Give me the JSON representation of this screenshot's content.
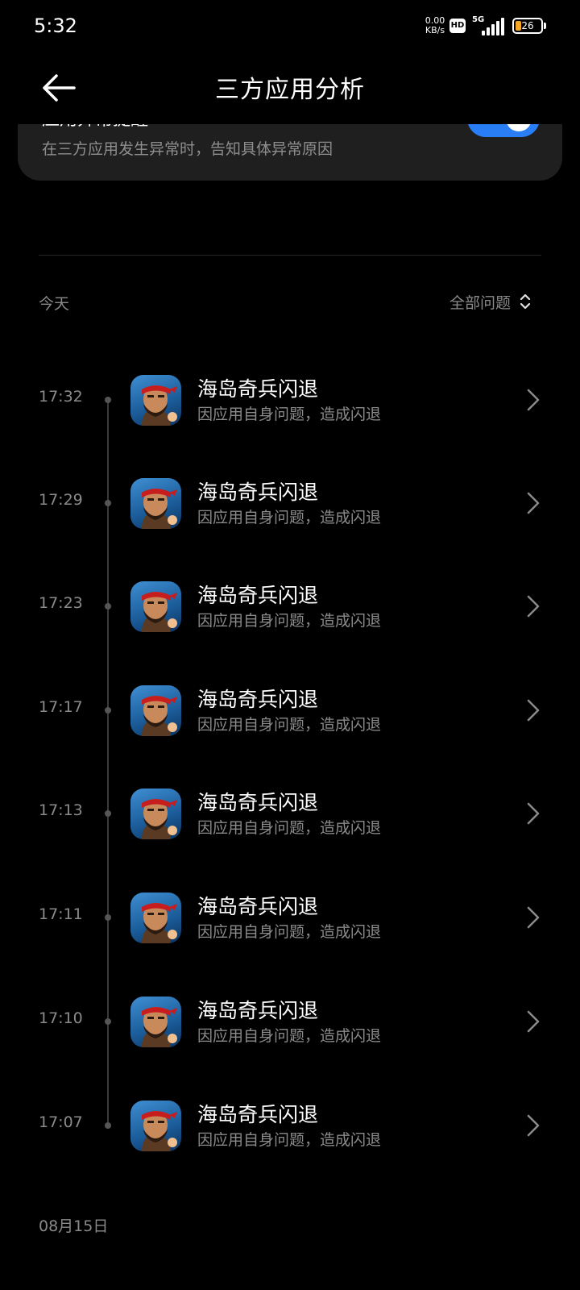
{
  "status_bar": {
    "time": "5:32",
    "net_speed_value": "0.00",
    "net_speed_unit": "KB/s",
    "hd_label": "HD",
    "network_type": "5G",
    "battery_level": "26"
  },
  "header": {
    "title": "三方应用分析"
  },
  "settings_card": {
    "title": "应用异常提醒",
    "description": "在三方应用发生异常时，告知具体异常原因",
    "toggle_on": true
  },
  "section_today": {
    "label": "今天",
    "filter_label": "全部问题"
  },
  "records": [
    {
      "time": "17:32",
      "app_name": "海岛奇兵闪退",
      "reason": "因应用自身问题，造成闪退"
    },
    {
      "time": "17:29",
      "app_name": "海岛奇兵闪退",
      "reason": "因应用自身问题，造成闪退"
    },
    {
      "time": "17:23",
      "app_name": "海岛奇兵闪退",
      "reason": "因应用自身问题，造成闪退"
    },
    {
      "time": "17:17",
      "app_name": "海岛奇兵闪退",
      "reason": "因应用自身问题，造成闪退"
    },
    {
      "time": "17:13",
      "app_name": "海岛奇兵闪退",
      "reason": "因应用自身问题，造成闪退"
    },
    {
      "time": "17:11",
      "app_name": "海岛奇兵闪退",
      "reason": "因应用自身问题，造成闪退"
    },
    {
      "time": "17:10",
      "app_name": "海岛奇兵闪退",
      "reason": "因应用自身问题，造成闪退"
    },
    {
      "time": "17:07",
      "app_name": "海岛奇兵闪退",
      "reason": "因应用自身问题，造成闪退"
    }
  ],
  "section_next": {
    "label": "08月15日"
  },
  "colors": {
    "background": "#000000",
    "card": "#1f1f1f",
    "accent": "#2a7ef5",
    "secondary_text": "#8a8a8a",
    "battery": "#f5a623"
  },
  "icons": {
    "back": "arrow-left-icon",
    "sort": "sort-updown-icon",
    "chevron": "chevron-right-icon",
    "app": "boom-beach-app-icon"
  }
}
